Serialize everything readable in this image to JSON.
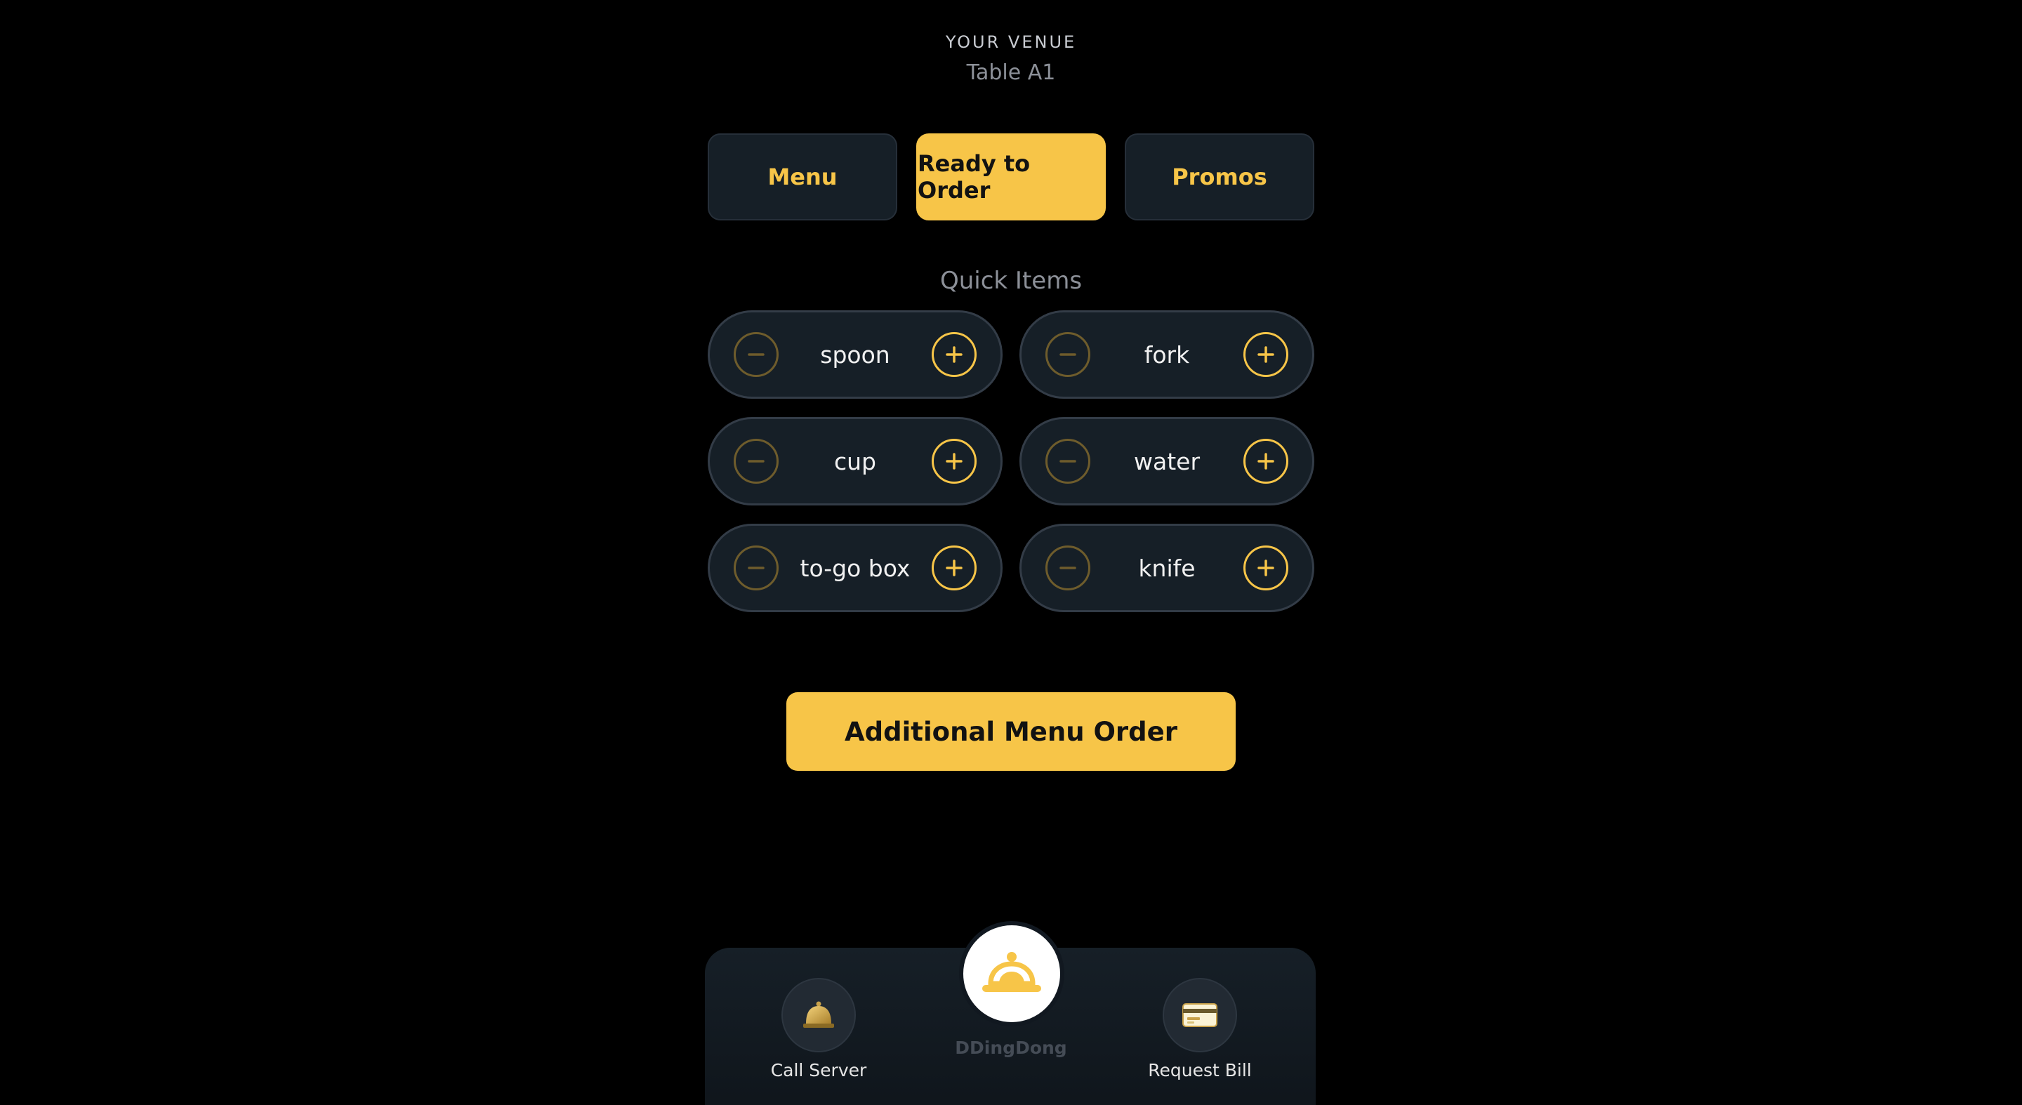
{
  "header": {
    "venue": "YOUR VENUE",
    "table": "Table A1"
  },
  "tabs": [
    {
      "label": "Menu",
      "active": false
    },
    {
      "label": "Ready to Order",
      "active": true
    },
    {
      "label": "Promos",
      "active": false
    }
  ],
  "quick_items": {
    "title": "Quick Items",
    "items": [
      {
        "label": "spoon"
      },
      {
        "label": "fork"
      },
      {
        "label": "cup"
      },
      {
        "label": "water"
      },
      {
        "label": "to-go box"
      },
      {
        "label": "knife"
      }
    ]
  },
  "actions": {
    "additional_order": "Additional Menu Order"
  },
  "bottom_nav": {
    "call_server": {
      "label": "Call Server",
      "icon": "bell-icon"
    },
    "center": {
      "label": "DDingDong",
      "icon": "service-dome-icon"
    },
    "request_bill": {
      "label": "Request Bill",
      "icon": "credit-card-icon"
    }
  },
  "colors": {
    "accent": "#f7c548",
    "background": "#000000",
    "card": "#161f27"
  }
}
